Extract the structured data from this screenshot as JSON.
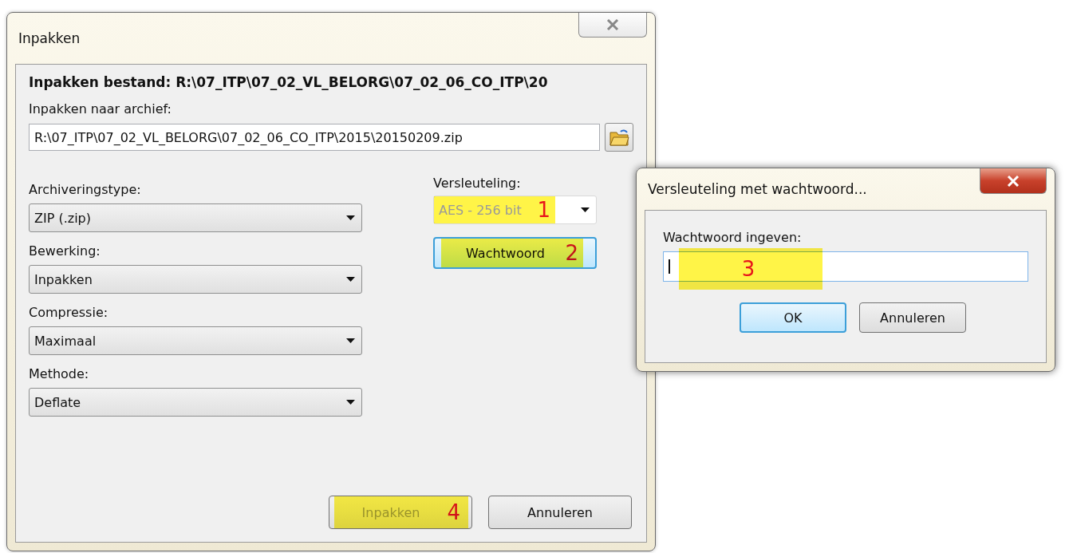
{
  "main_window": {
    "title": "Inpakken",
    "heading": "Inpakken bestand: R:\\07_ITP\\07_02_VL_BELORG\\07_02_06_CO_ITP\\20",
    "archive_label": "Inpakken naar archief:",
    "archive_path": "R:\\07_ITP\\07_02_VL_BELORG\\07_02_06_CO_ITP\\2015\\20150209.zip",
    "options": [
      {
        "label": "Archiveringstype:",
        "value": "ZIP (.zip)"
      },
      {
        "label": "Bewerking:",
        "value": "Inpakken"
      },
      {
        "label": "Compressie:",
        "value": "Maximaal"
      },
      {
        "label": "Methode:",
        "value": "Deflate"
      }
    ],
    "encryption": {
      "label": "Versleuteling:",
      "value": "AES - 256 bit",
      "disabled": true,
      "marker": "1"
    },
    "password_button": {
      "label": "Wachtwoord",
      "focused": true,
      "marker": "2"
    },
    "buttons": [
      {
        "label": "Inpakken",
        "disabled": true,
        "marker": "4"
      },
      {
        "label": "Annuleren",
        "disabled": false
      }
    ]
  },
  "password_dialog": {
    "title": "Versleuteling met wachtwoord...",
    "field_label": "Wachtwoord ingeven:",
    "marker": "3",
    "buttons": [
      {
        "label": "OK",
        "focused": true
      },
      {
        "label": "Annuleren",
        "focused": false
      }
    ]
  }
}
